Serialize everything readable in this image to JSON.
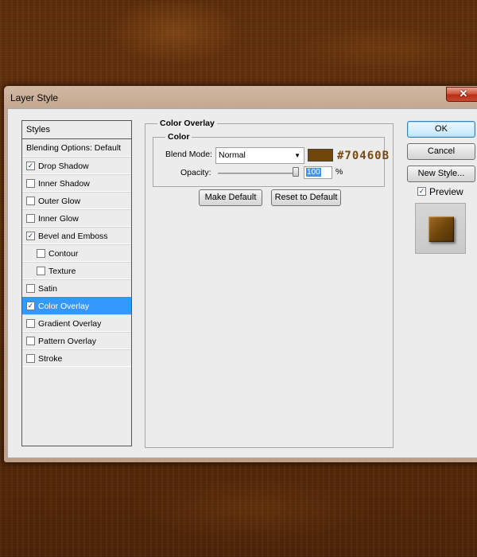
{
  "window": {
    "title": "Layer Style",
    "close_glyph": "✕"
  },
  "styles_list": {
    "header": "Styles",
    "blending_options": "Blending Options: Default",
    "items": [
      {
        "label": "Drop Shadow",
        "checked": true
      },
      {
        "label": "Inner Shadow",
        "checked": false
      },
      {
        "label": "Outer Glow",
        "checked": false
      },
      {
        "label": "Inner Glow",
        "checked": false
      },
      {
        "label": "Bevel and Emboss",
        "checked": true
      },
      {
        "label": "Contour",
        "checked": false
      },
      {
        "label": "Texture",
        "checked": false
      },
      {
        "label": "Satin",
        "checked": false
      },
      {
        "label": "Color Overlay",
        "checked": true
      },
      {
        "label": "Gradient Overlay",
        "checked": false
      },
      {
        "label": "Pattern Overlay",
        "checked": false
      },
      {
        "label": "Stroke",
        "checked": false
      }
    ],
    "selected": "Color Overlay"
  },
  "color_overlay": {
    "section_title": "Color Overlay",
    "group_title": "Color",
    "blend_mode_label": "Blend Mode:",
    "blend_mode_value": "Normal",
    "swatch_color": "#70460b",
    "hex_text": "#70460B",
    "hex_color": "#7a4a10",
    "opacity_label": "Opacity:",
    "opacity_value": "100",
    "opacity_unit": "%",
    "opacity_fraction": 1.0,
    "make_default": "Make Default",
    "reset_default": "Reset to Default"
  },
  "actions": {
    "ok": "OK",
    "cancel": "Cancel",
    "new_style": "New Style...",
    "preview_label": "Preview",
    "preview_checked": true
  },
  "checkmark_glyph": "✓"
}
